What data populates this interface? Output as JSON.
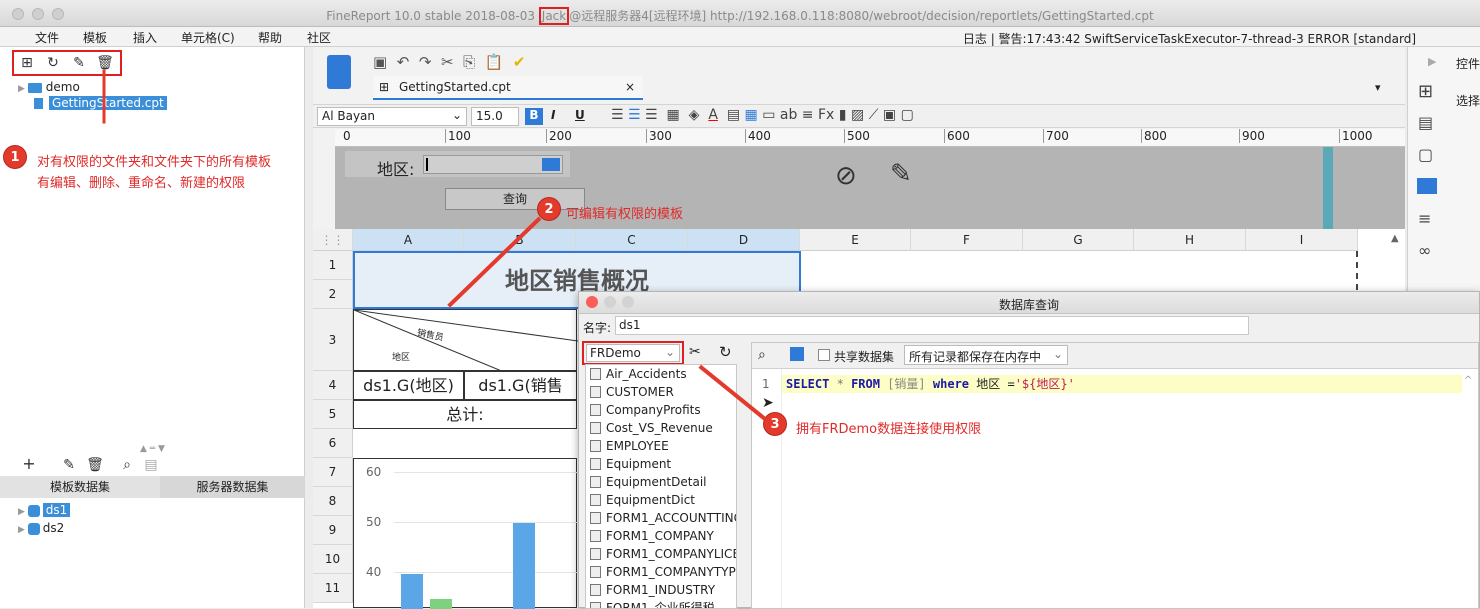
{
  "window": {
    "title_prefix": "FineReport 10.0 stable 2018-08-03 ",
    "title_highlight": "Jack",
    "title_suffix": "@远程服务器4[远程环境]   http://192.168.0.118:8080/webroot/decision/reportlets/GettingStarted.cpt"
  },
  "menu": {
    "items": [
      "文件",
      "模板",
      "插入",
      "单元格(C)",
      "帮助",
      "社区"
    ],
    "log": "日志 | 警告:17:43:42 SwiftServiceTaskExecutor-7-thread-3 ERROR [standard]"
  },
  "tree": {
    "folder": "demo",
    "file": "GettingStarted.cpt"
  },
  "annotations": {
    "a1_num": "1",
    "a1_line1": "对有权限的文件夹和文件夹下的所有模板",
    "a1_line2": "有编辑、删除、重命名、新建的权限",
    "a2_num": "2",
    "a2_text": "可编辑有权限的模板",
    "a3_num": "3",
    "a3_text": "拥有FRDemo数据连接使用权限"
  },
  "datasets": {
    "tab_template": "模板数据集",
    "tab_server": "服务器数据集",
    "items": [
      "ds1",
      "ds2"
    ]
  },
  "editor": {
    "tab": "GettingStarted.cpt",
    "tab_close": "×",
    "font": "Al Bayan",
    "font_size": "15.0",
    "bold": "B",
    "italic": "I",
    "underline": "U",
    "ruler": [
      "0",
      "100",
      "200",
      "300",
      "400",
      "500",
      "600",
      "700",
      "800",
      "900",
      "1000"
    ],
    "param_label": "地区:",
    "query_button": "查询"
  },
  "sheet": {
    "columns": [
      "A",
      "B",
      "C",
      "D",
      "E",
      "F",
      "G",
      "H",
      "I"
    ],
    "rows": [
      "1",
      "2",
      "3",
      "4",
      "5",
      "6",
      "7",
      "8",
      "9",
      "10",
      "11"
    ],
    "title": "地区销售概况",
    "diag_top": "销售员",
    "diag_bottom": "地区",
    "cell_a4": "ds1.G(地区)",
    "cell_b4": "ds1.G(销售",
    "cell_total": "总计:",
    "chart_ticks": [
      "60",
      "50",
      "40"
    ]
  },
  "right_panel": {
    "label1": "控件",
    "label2": "选择"
  },
  "dialog": {
    "title": "数据库查询",
    "name_label": "名字:",
    "name_value": "ds1",
    "connection": "FRDemo",
    "share": "共享数据集",
    "memory": "所有记录都保存在内存中",
    "sql_line": "1",
    "sql_select": "SELECT",
    "sql_star": "*",
    "sql_from": "FROM",
    "sql_table": "[销量]",
    "sql_where": "where",
    "sql_field": "地区 =",
    "sql_value": "'${地区}'",
    "tables": [
      "Air_Accidents",
      "CUSTOMER",
      "CompanyProfits",
      "Cost_VS_Revenue",
      "EMPLOYEE",
      "Equipment",
      "EquipmentDetail",
      "EquipmentDict",
      "FORM1_ACCOUNTTING",
      "FORM1_COMPANY",
      "FORM1_COMPANYLICE",
      "FORM1_COMPANYTYP",
      "FORM1_INDUSTRY",
      "FORM1_企业所得税"
    ]
  },
  "colors": {
    "accent": "#2f7ad6",
    "annotation_red": "#e02a2a",
    "selection": "#3b8fd8",
    "sql_highlight": "#fdfdc6"
  }
}
